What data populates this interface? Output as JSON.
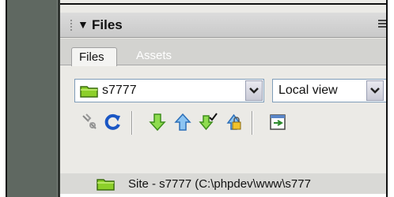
{
  "panel": {
    "title": "Files",
    "tabs": [
      {
        "label": "Files",
        "active": true
      },
      {
        "label": "Assets",
        "active": false
      }
    ]
  },
  "site_select": {
    "value": "s7777"
  },
  "view_select": {
    "value": "Local view"
  },
  "toolbar": {
    "icons": [
      "connect-icon",
      "refresh-icon",
      "get-files-icon",
      "put-files-icon",
      "check-out-icon",
      "check-in-icon",
      "expand-icon"
    ]
  },
  "file_tree": {
    "root_label": "Site - s7777 (C:\\phpdev\\www\\s777"
  },
  "colors": {
    "folder": "#8ccf2a",
    "arrow_green": "#5fbe2e",
    "arrow_blue": "#3a88d8",
    "refresh_blue": "#1a56c4"
  }
}
